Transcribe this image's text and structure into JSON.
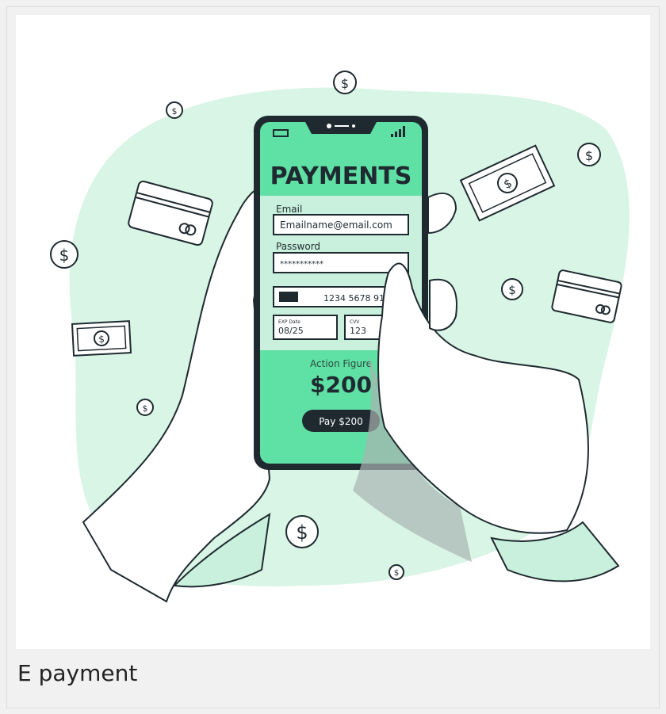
{
  "caption": "E payment",
  "phone": {
    "title": "PAYMENTS",
    "email_label": "Email",
    "email_value": "Emailname@email.com",
    "password_label": "Password",
    "password_value": "***********",
    "card_number": "1234 5678 910",
    "exp_label": "EXP Date",
    "exp_value": "08/25",
    "cvv_label": "CVV",
    "cvv_value": "123",
    "item_label": "Action Figure",
    "amount": "$200",
    "pay_button": "Pay $200"
  },
  "colors": {
    "blob": "#d8f5e6",
    "screen_green": "#5fe0a5",
    "form_green": "#c9f0dc",
    "dark": "#1f2a30",
    "hand": "#ffffff",
    "shadow": "#a9b3b0"
  }
}
